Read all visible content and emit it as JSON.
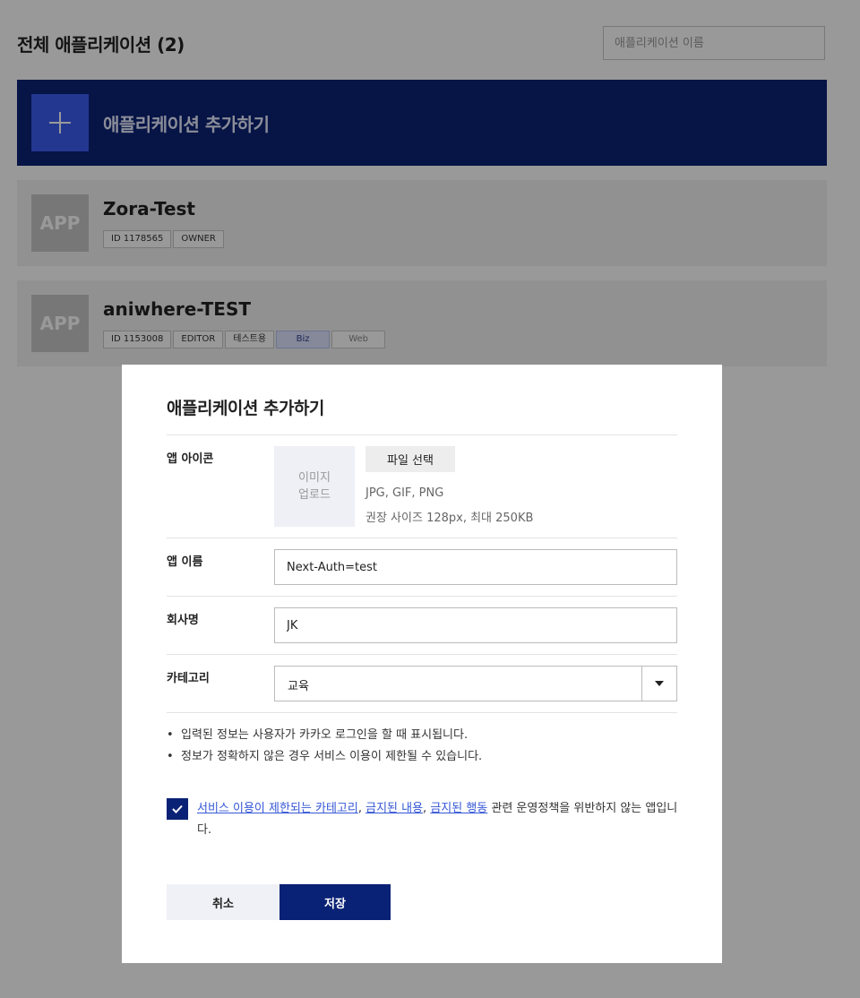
{
  "header": {
    "title": "전체 애플리케이션 (2)",
    "search_placeholder": "애플리케이션 이름"
  },
  "add_banner": {
    "label": "애플리케이션 추가하기",
    "icon": "plus-icon"
  },
  "apps": [
    {
      "thumb": "APP",
      "name": "Zora-Test",
      "tags": [
        "ID 1178565",
        "OWNER"
      ]
    },
    {
      "thumb": "APP",
      "name": "aniwhere-TEST",
      "tags": [
        "ID 1153008",
        "EDITOR",
        "테스트용"
      ],
      "platforms": [
        "Biz",
        "Web"
      ]
    }
  ],
  "modal": {
    "title": "애플리케이션 추가하기",
    "icon_field": {
      "label": "앱 아이콘",
      "preview_line1": "이미지",
      "preview_line2": "업로드",
      "button": "파일 선택",
      "formats": "JPG, GIF, PNG",
      "size_hint": "권장 사이즈 128px, 최대 250KB"
    },
    "name_field": {
      "label": "앱 이름",
      "value": "Next-Auth=test"
    },
    "company_field": {
      "label": "회사명",
      "value": "JK"
    },
    "category_field": {
      "label": "카테고리",
      "value": "교육"
    },
    "notes": [
      "입력된 정보는 사용자가 카카오 로그인을 할 때 표시됩니다.",
      "정보가 정확하지 않은 경우 서비스 이용이 제한될 수 있습니다."
    ],
    "agreement": {
      "checked": true,
      "link1": "서비스 이용이 제한되는 카테고리",
      "sep1": ", ",
      "link2": "금지된 내용",
      "sep2": ", ",
      "link3": "금지된 행동",
      "rest": " 관련 운영정책을 위반하지 않는 앱입니다."
    },
    "cancel_label": "취소",
    "save_label": "저장"
  },
  "colors": {
    "navy": "#0a2275",
    "accent_blue": "#3b5df2",
    "link": "#3557d6"
  }
}
